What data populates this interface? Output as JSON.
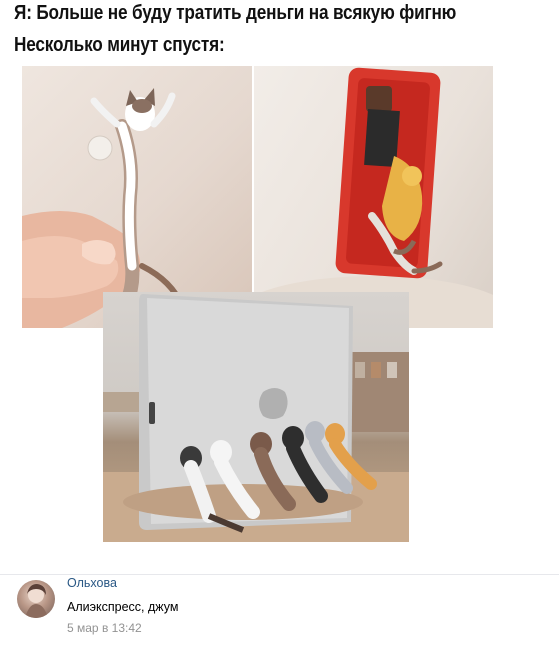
{
  "meme": {
    "caption_line1": "Я: Больше не буду тратить деньги на всякую фигню",
    "caption_line2": "Несколько минут спустя:"
  },
  "comment": {
    "author": "Ольхова",
    "text": "Алиэкспресс, джум",
    "date": "5 мар в 13:42"
  },
  "colors": {
    "link": "#2a5885",
    "muted": "#939393",
    "divider": "#e7e8ec"
  }
}
